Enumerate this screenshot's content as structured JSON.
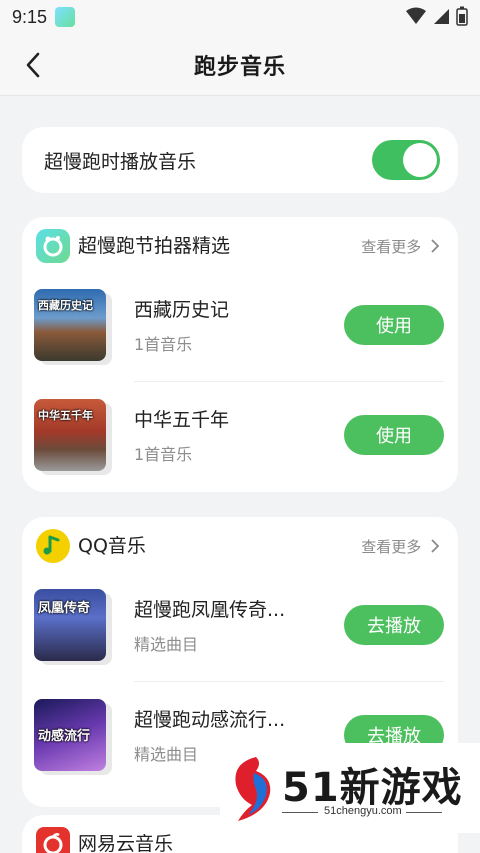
{
  "status_bar": {
    "time": "9:15"
  },
  "header": {
    "title": "跑步音乐"
  },
  "toggle": {
    "label": "超慢跑时播放音乐",
    "enabled": true,
    "color": "#3fbf5f"
  },
  "sections": [
    {
      "name": "超慢跑节拍器精选",
      "more_label": "查看更多",
      "items": [
        {
          "title": "西藏历史记",
          "subtitle": "1首音乐",
          "button": "使用",
          "cover_text": "西藏历史记"
        },
        {
          "title": "中华五千年",
          "subtitle": "1首音乐",
          "button": "使用",
          "cover_text": "中华五千年"
        }
      ]
    },
    {
      "name": "QQ音乐",
      "more_label": "查看更多",
      "items": [
        {
          "title": "超慢跑凤凰传奇...",
          "subtitle": "精选曲目",
          "button": "去播放",
          "cover_text": "凤凰传奇"
        },
        {
          "title": "超慢跑动感流行...",
          "subtitle": "精选曲目",
          "button": "去播放",
          "cover_text": "动感流行"
        }
      ]
    },
    {
      "name": "网易云音乐"
    }
  ],
  "watermark": {
    "text": "51新游戏",
    "url": "51chengyu.com"
  },
  "colors": {
    "accent_green": "#4cc05e",
    "background": "#f2f3f5"
  }
}
